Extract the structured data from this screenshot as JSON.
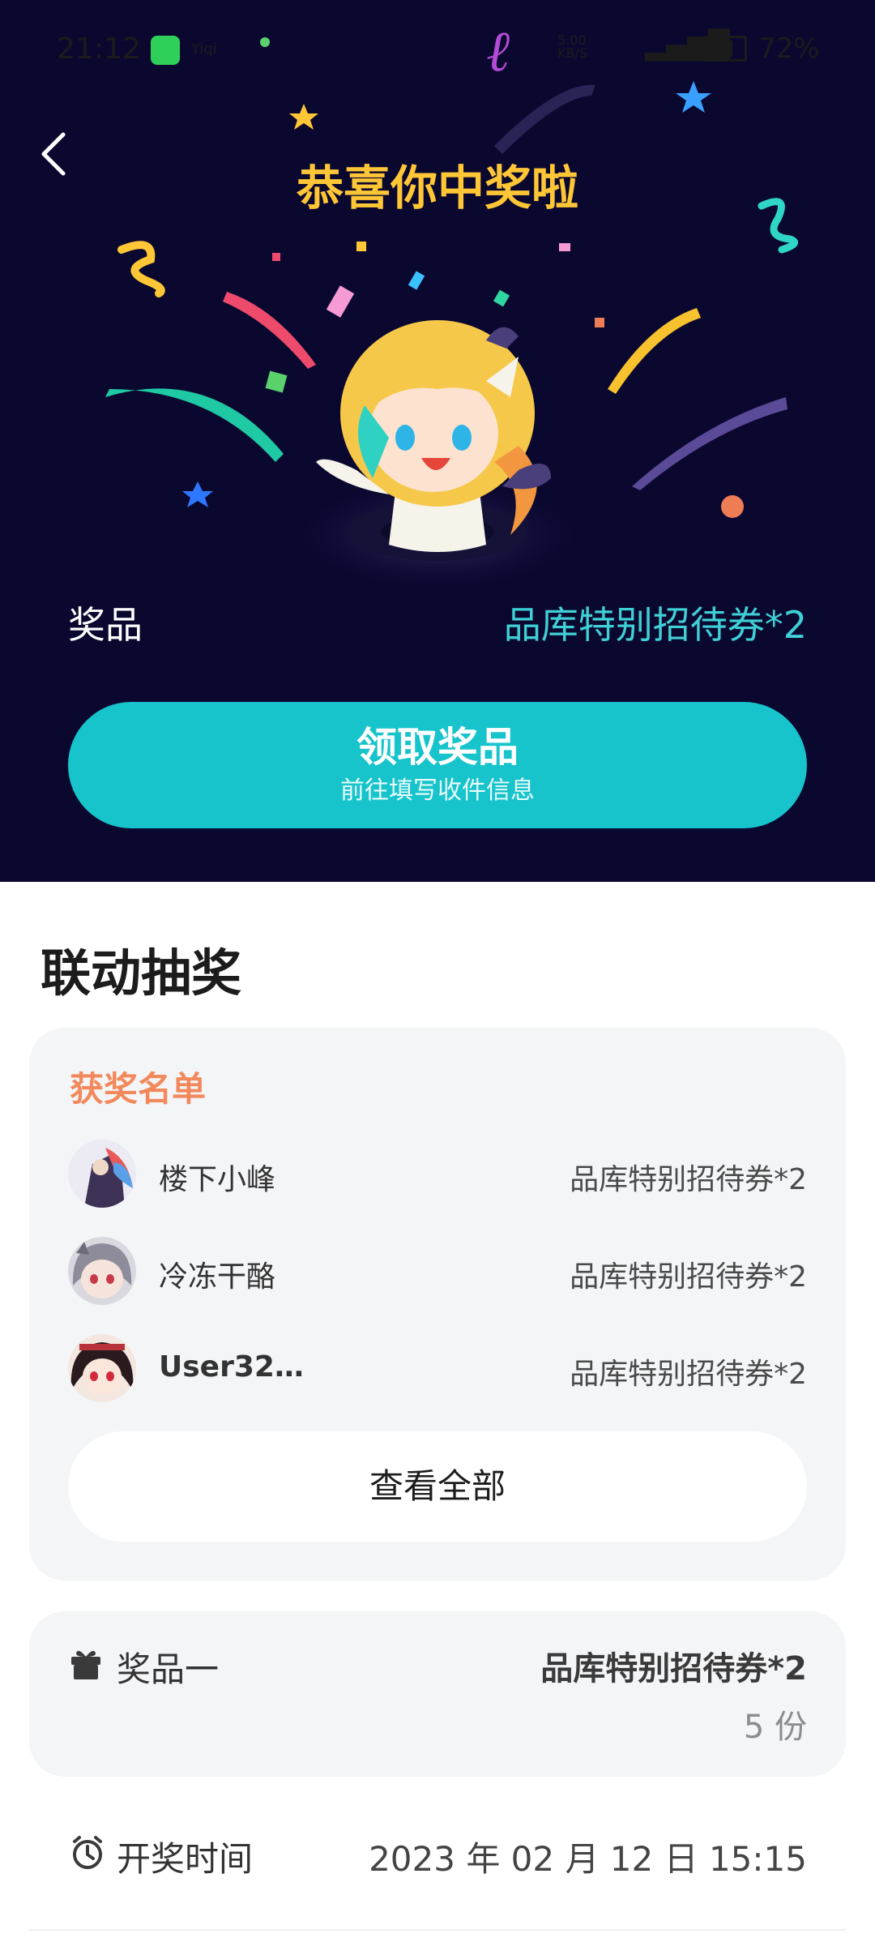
{
  "status_bar": {
    "time": "21:12",
    "app_badge": "Yiqi",
    "network": "5.00 KB/S",
    "battery": "72%"
  },
  "hero": {
    "title": "恭喜你中奖啦",
    "prize_label": "奖品",
    "prize_value": "品库特别招待券*2",
    "claim_button": {
      "label": "领取奖品",
      "sublabel": "前往填写收件信息"
    },
    "background_color": "#0b0830",
    "title_color": "#ffc636",
    "accent_color": "#17c4cc"
  },
  "section_title": "联动抽奖",
  "winners": {
    "header": "获奖名单",
    "rows": [
      {
        "name": "楼下小峰",
        "prize": "品库特别招待券*2"
      },
      {
        "name": "冷冻干酪",
        "prize": "品库特别招待券*2"
      },
      {
        "name": "User32…",
        "prize": "品库特别招待券*2"
      }
    ],
    "view_all": "查看全部"
  },
  "prize_item": {
    "label": "奖品一",
    "value": "品库特别招待券*2",
    "count": "5 份"
  },
  "draw_time": {
    "label": "开奖时间",
    "value": "2023 年 02 月 12 日 15:15"
  }
}
